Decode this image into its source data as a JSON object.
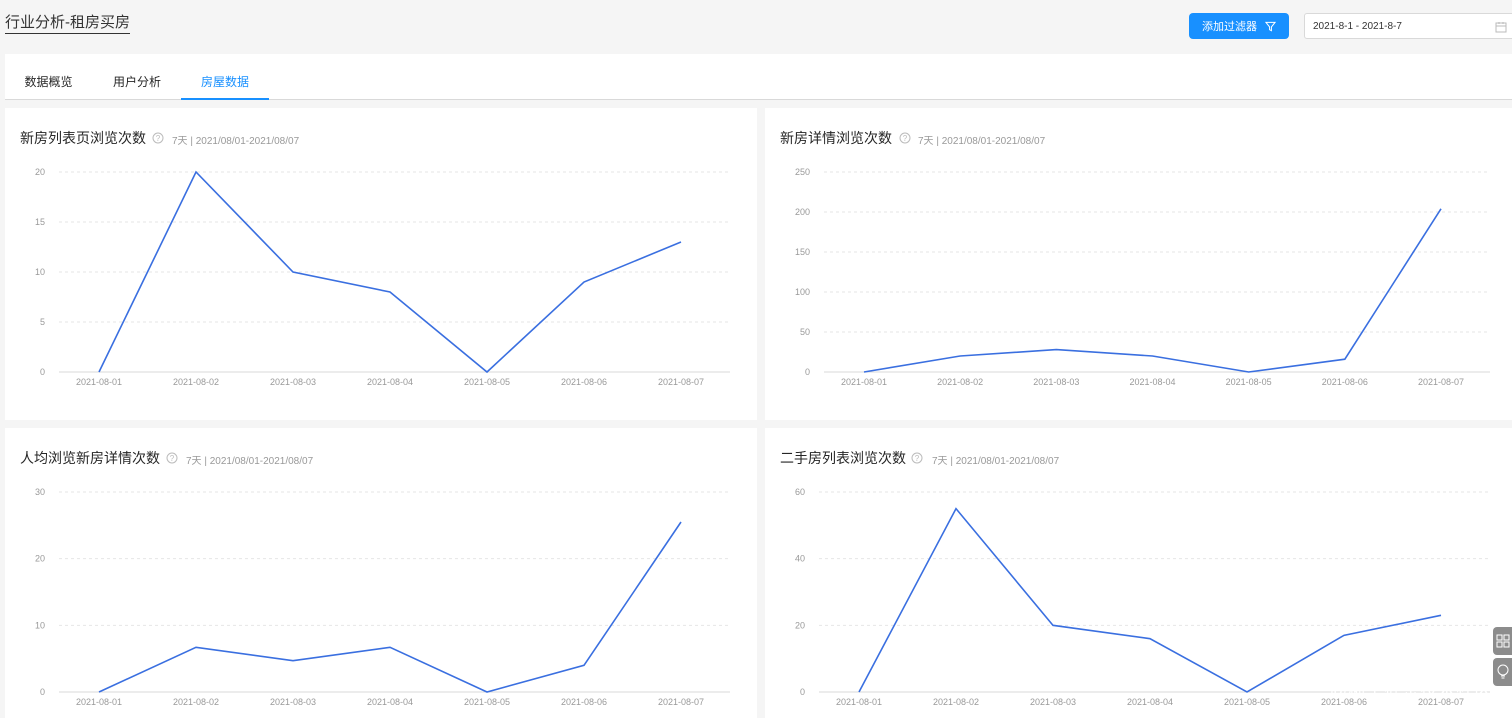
{
  "header": {
    "title": "行业分析-租房买房",
    "add_filter_label": "添加过滤器",
    "date_range": "2021-8-1 - 2021-8-7"
  },
  "tabs": [
    {
      "label": "数据概览"
    },
    {
      "label": "用户分析"
    },
    {
      "label": "房屋数据"
    }
  ],
  "colors": {
    "accent": "#1890ff",
    "line": "#3a6fe0",
    "grid": "#e6e6e6"
  },
  "watermark": "@稀土掘金技术社区",
  "chart_data": [
    {
      "type": "line",
      "title": "新房列表页浏览次数",
      "subtitle": "7天 | 2021/08/01-2021/08/07",
      "categories": [
        "2021-08-01",
        "2021-08-02",
        "2021-08-03",
        "2021-08-04",
        "2021-08-05",
        "2021-08-06",
        "2021-08-07"
      ],
      "values": [
        0,
        20,
        10,
        8,
        0,
        9,
        13
      ],
      "yticks": [
        0,
        5,
        10,
        15,
        20
      ],
      "ylim": [
        0,
        20
      ],
      "grid": true
    },
    {
      "type": "line",
      "title": "新房详情浏览次数",
      "subtitle": "7天 | 2021/08/01-2021/08/07",
      "categories": [
        "2021-08-01",
        "2021-08-02",
        "2021-08-03",
        "2021-08-04",
        "2021-08-05",
        "2021-08-06",
        "2021-08-07"
      ],
      "values": [
        0,
        20,
        28,
        20,
        0,
        16,
        204
      ],
      "yticks": [
        0,
        50,
        100,
        150,
        200,
        250
      ],
      "ylim": [
        0,
        250
      ],
      "grid": true
    },
    {
      "type": "line",
      "title": "人均浏览新房详情次数",
      "subtitle": "7天 | 2021/08/01-2021/08/07",
      "categories": [
        "2021-08-01",
        "2021-08-02",
        "2021-08-03",
        "2021-08-04",
        "2021-08-05",
        "2021-08-06",
        "2021-08-07"
      ],
      "values": [
        0,
        6.7,
        4.7,
        6.7,
        0,
        4,
        25.5
      ],
      "yticks": [
        0,
        10,
        20,
        30
      ],
      "ylim": [
        0,
        30
      ],
      "grid": true
    },
    {
      "type": "line",
      "title": "二手房列表浏览次数",
      "subtitle": "7天 | 2021/08/01-2021/08/07",
      "categories": [
        "2021-08-01",
        "2021-08-02",
        "2021-08-03",
        "2021-08-04",
        "2021-08-05",
        "2021-08-06",
        "2021-08-07"
      ],
      "values": [
        0,
        55,
        20,
        16,
        0,
        17,
        23
      ],
      "yticks": [
        0,
        20,
        40,
        60
      ],
      "ylim": [
        0,
        60
      ],
      "grid": true
    }
  ]
}
